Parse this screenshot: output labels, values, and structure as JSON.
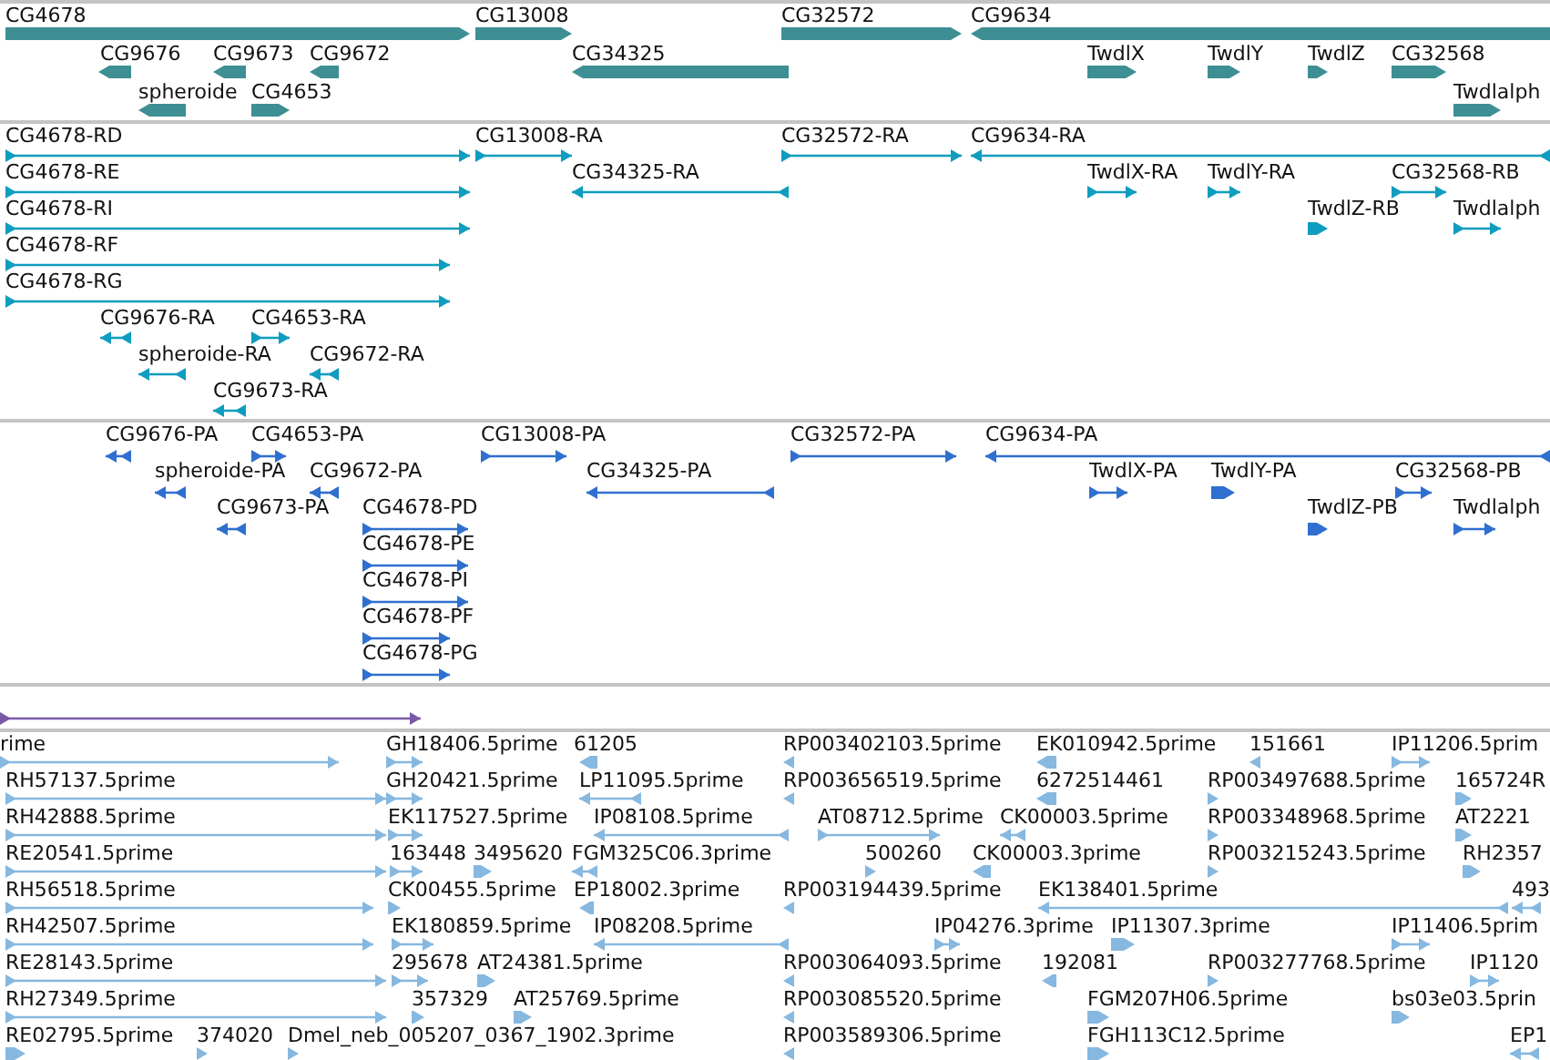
{
  "tracks": [
    {
      "kind": "gene",
      "color": "#3d8f94",
      "features": [
        {
          "label": "CG4678",
          "reverse": false
        },
        {
          "label": "CG13008",
          "reverse": false
        },
        {
          "label": "CG32572",
          "reverse": false
        },
        {
          "label": "CG9634",
          "reverse": true
        },
        {
          "label": "CG9676",
          "reverse": true
        },
        {
          "label": "CG9673",
          "reverse": true
        },
        {
          "label": "CG9672",
          "reverse": true
        },
        {
          "label": "CG34325",
          "reverse": true
        },
        {
          "label": "TwdlX",
          "reverse": false
        },
        {
          "label": "TwdlY",
          "reverse": false
        },
        {
          "label": "TwdlZ",
          "reverse": false
        },
        {
          "label": "CG32568",
          "reverse": false
        },
        {
          "label": "spheroide",
          "reverse": true
        },
        {
          "label": "CG4653",
          "reverse": false
        },
        {
          "label": "Twdlalph",
          "reverse": false
        }
      ]
    },
    {
      "kind": "transcript",
      "color": "#0f9dbf",
      "features": [
        {
          "label": "CG4678-RD",
          "reverse": false
        },
        {
          "label": "CG13008-RA",
          "reverse": false
        },
        {
          "label": "CG32572-RA",
          "reverse": false
        },
        {
          "label": "CG9634-RA",
          "reverse": true
        },
        {
          "label": "CG4678-RE",
          "reverse": false
        },
        {
          "label": "CG34325-RA",
          "reverse": true
        },
        {
          "label": "TwdlX-RA",
          "reverse": false
        },
        {
          "label": "TwdlY-RA",
          "reverse": false
        },
        {
          "label": "CG32568-RB",
          "reverse": false
        },
        {
          "label": "CG4678-RI",
          "reverse": false
        },
        {
          "label": "TwdlZ-RB",
          "reverse": false
        },
        {
          "label": "Twdlalph",
          "reverse": false
        },
        {
          "label": "CG4678-RF",
          "reverse": false
        },
        {
          "label": "CG4678-RG",
          "reverse": false
        },
        {
          "label": "CG9676-RA",
          "reverse": true
        },
        {
          "label": "CG4653-RA",
          "reverse": false
        },
        {
          "label": "spheroide-RA",
          "reverse": true
        },
        {
          "label": "CG9672-RA",
          "reverse": true
        },
        {
          "label": "CG9673-RA",
          "reverse": true
        }
      ]
    },
    {
      "kind": "protein",
      "color": "#2f6fcf",
      "features": [
        {
          "label": "CG9676-PA",
          "reverse": true
        },
        {
          "label": "CG4653-PA",
          "reverse": false
        },
        {
          "label": "CG13008-PA",
          "reverse": false
        },
        {
          "label": "CG32572-PA",
          "reverse": false
        },
        {
          "label": "CG9634-PA",
          "reverse": true
        },
        {
          "label": "spheroide-PA",
          "reverse": true
        },
        {
          "label": "CG9672-PA",
          "reverse": true
        },
        {
          "label": "CG34325-PA",
          "reverse": true
        },
        {
          "label": "TwdlX-PA",
          "reverse": false
        },
        {
          "label": "TwdlY-PA",
          "reverse": false
        },
        {
          "label": "CG32568-PB",
          "reverse": false
        },
        {
          "label": "CG9673-PA",
          "reverse": true
        },
        {
          "label": "CG4678-PD",
          "reverse": false
        },
        {
          "label": "TwdlZ-PB",
          "reverse": false
        },
        {
          "label": "Twdlalph",
          "reverse": false
        },
        {
          "label": "CG4678-PE",
          "reverse": false
        },
        {
          "label": "CG4678-PI",
          "reverse": false
        },
        {
          "label": "CG4678-PF",
          "reverse": false
        },
        {
          "label": "CG4678-PG",
          "reverse": false
        }
      ]
    },
    {
      "kind": "match",
      "color": "#7a5aa8",
      "features": [
        {
          "reverse": false
        }
      ]
    },
    {
      "kind": "est",
      "color": "#86b8e0",
      "features": [
        {
          "label": "rime",
          "reverse": false
        },
        {
          "label": "GH18406.5prime",
          "reverse": false
        },
        {
          "label": "61205",
          "reverse": true
        },
        {
          "label": "RP003402103.5prime",
          "reverse": true
        },
        {
          "label": "EK010942.5prime",
          "reverse": true
        },
        {
          "label": "151661",
          "reverse": true
        },
        {
          "label": "IP11206.5prim",
          "reverse": false
        },
        {
          "label": "RH57137.5prime",
          "reverse": false
        },
        {
          "label": "GH20421.5prime",
          "reverse": false
        },
        {
          "label": "LP11095.5prime",
          "reverse": true
        },
        {
          "label": "RP003656519.5prime",
          "reverse": true
        },
        {
          "label": "6272514461",
          "reverse": true
        },
        {
          "label": "RP003497688.5prime",
          "reverse": false
        },
        {
          "label": "165724R",
          "reverse": false
        },
        {
          "label": "RH42888.5prime",
          "reverse": false
        },
        {
          "label": "EK117527.5prime",
          "reverse": false
        },
        {
          "label": "IP08108.5prime",
          "reverse": true
        },
        {
          "label": "AT08712.5prime",
          "reverse": false
        },
        {
          "label": "CK00003.5prime",
          "reverse": true
        },
        {
          "label": "RP003348968.5prime",
          "reverse": false
        },
        {
          "label": "AT2221",
          "reverse": false
        },
        {
          "label": "RE20541.5prime",
          "reverse": false
        },
        {
          "label": "163448",
          "reverse": false
        },
        {
          "label": "3495620",
          "reverse": false
        },
        {
          "label": "FGM325C06.3prime",
          "reverse": true
        },
        {
          "label": "500260",
          "reverse": false
        },
        {
          "label": "CK00003.3prime",
          "reverse": true
        },
        {
          "label": "RP003215243.5prime",
          "reverse": false
        },
        {
          "label": "RH2357",
          "reverse": false
        },
        {
          "label": "RH56518.5prime",
          "reverse": false
        },
        {
          "label": "CK00455.5prime",
          "reverse": false
        },
        {
          "label": "EP18002.3prime",
          "reverse": true
        },
        {
          "label": "RP003194439.5prime",
          "reverse": true
        },
        {
          "label": "EK138401.5prime",
          "reverse": true
        },
        {
          "label": "493",
          "reverse": true
        },
        {
          "label": "RH42507.5prime",
          "reverse": false
        },
        {
          "label": "EK180859.5prime",
          "reverse": false
        },
        {
          "label": "IP08208.5prime",
          "reverse": true
        },
        {
          "label": "IP04276.3prime",
          "reverse": false
        },
        {
          "label": "IP11307.3prime",
          "reverse": false
        },
        {
          "label": "IP11406.5prim",
          "reverse": false
        },
        {
          "label": "RE28143.5prime",
          "reverse": false
        },
        {
          "label": "295678",
          "reverse": false
        },
        {
          "label": "AT24381.5prime",
          "reverse": false
        },
        {
          "label": "RP003064093.5prime",
          "reverse": true
        },
        {
          "label": "192081",
          "reverse": true
        },
        {
          "label": "RP003277768.5prime",
          "reverse": false
        },
        {
          "label": "IP1120",
          "reverse": false
        },
        {
          "label": "RH27349.5prime",
          "reverse": false
        },
        {
          "label": "357329",
          "reverse": false
        },
        {
          "label": "AT25769.5prime",
          "reverse": false
        },
        {
          "label": "RP003085520.5prime",
          "reverse": true
        },
        {
          "label": "FGM207H06.5prime",
          "reverse": false
        },
        {
          "label": "bs03e03.5prin",
          "reverse": false
        },
        {
          "label": "RE02795.5prime",
          "reverse": false
        },
        {
          "label": "374020",
          "reverse": false
        },
        {
          "label": "Dmel_neb_005207_0367_1902.3prime",
          "reverse": false
        },
        {
          "label": "RP003589306.5prime",
          "reverse": true
        },
        {
          "label": "FGH113C12.5prime",
          "reverse": false
        },
        {
          "label": "EP1",
          "reverse": true
        }
      ]
    }
  ]
}
